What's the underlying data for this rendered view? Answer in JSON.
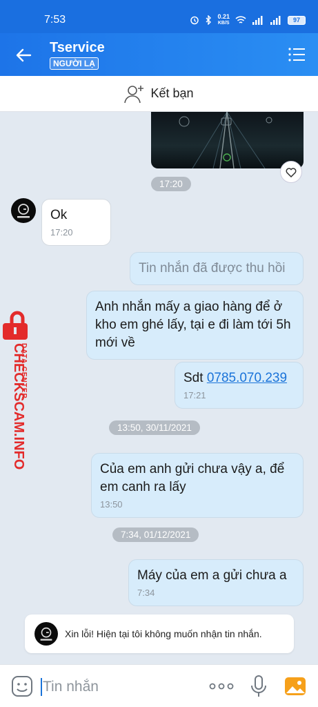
{
  "status_bar": {
    "time": "7:53",
    "network_speed": "0.21",
    "network_unit": "KB/S",
    "battery": "97"
  },
  "header": {
    "contact_name": "Tservice",
    "badge": "NGƯỜI LẠ"
  },
  "friend_bar": {
    "label": "Kết bạn"
  },
  "chat": {
    "image_time": "17:20",
    "messages": [
      {
        "direction": "in",
        "text": "Ok",
        "time": "17:20"
      },
      {
        "direction": "out",
        "text": "Tin nhắn đã được thu hồi",
        "recalled": true
      },
      {
        "direction": "out",
        "text": "Anh nhắn mấy a giao hàng để ở kho em ghé lấy, tại e đi làm tới 5h mới về"
      },
      {
        "direction": "out",
        "prefix": "Sdt ",
        "link": "0785.070.239",
        "time": "17:21"
      },
      {
        "direction": "out",
        "text": "Của em anh gửi chưa vậy a, để em canh ra lấy",
        "time": "13:50"
      },
      {
        "direction": "out",
        "text": "Máy của em a gửi chưa a",
        "time": "7:34"
      }
    ],
    "dividers": [
      "13:50, 30/11/2021",
      "7:34, 01/12/2021"
    ]
  },
  "watermark": {
    "line1": "DATA CENTER",
    "line2": "CHECKSCAM.INFO"
  },
  "notice": {
    "text": "Xin lỗi! Hiện tại tôi không muốn nhận tin nhắn."
  },
  "input": {
    "placeholder": "Tin nhắn"
  },
  "colors": {
    "header": "#1d74e8",
    "outgoing_bubble": "#d7ecfb",
    "link": "#1a73d9",
    "watermark": "#e32b2b"
  }
}
